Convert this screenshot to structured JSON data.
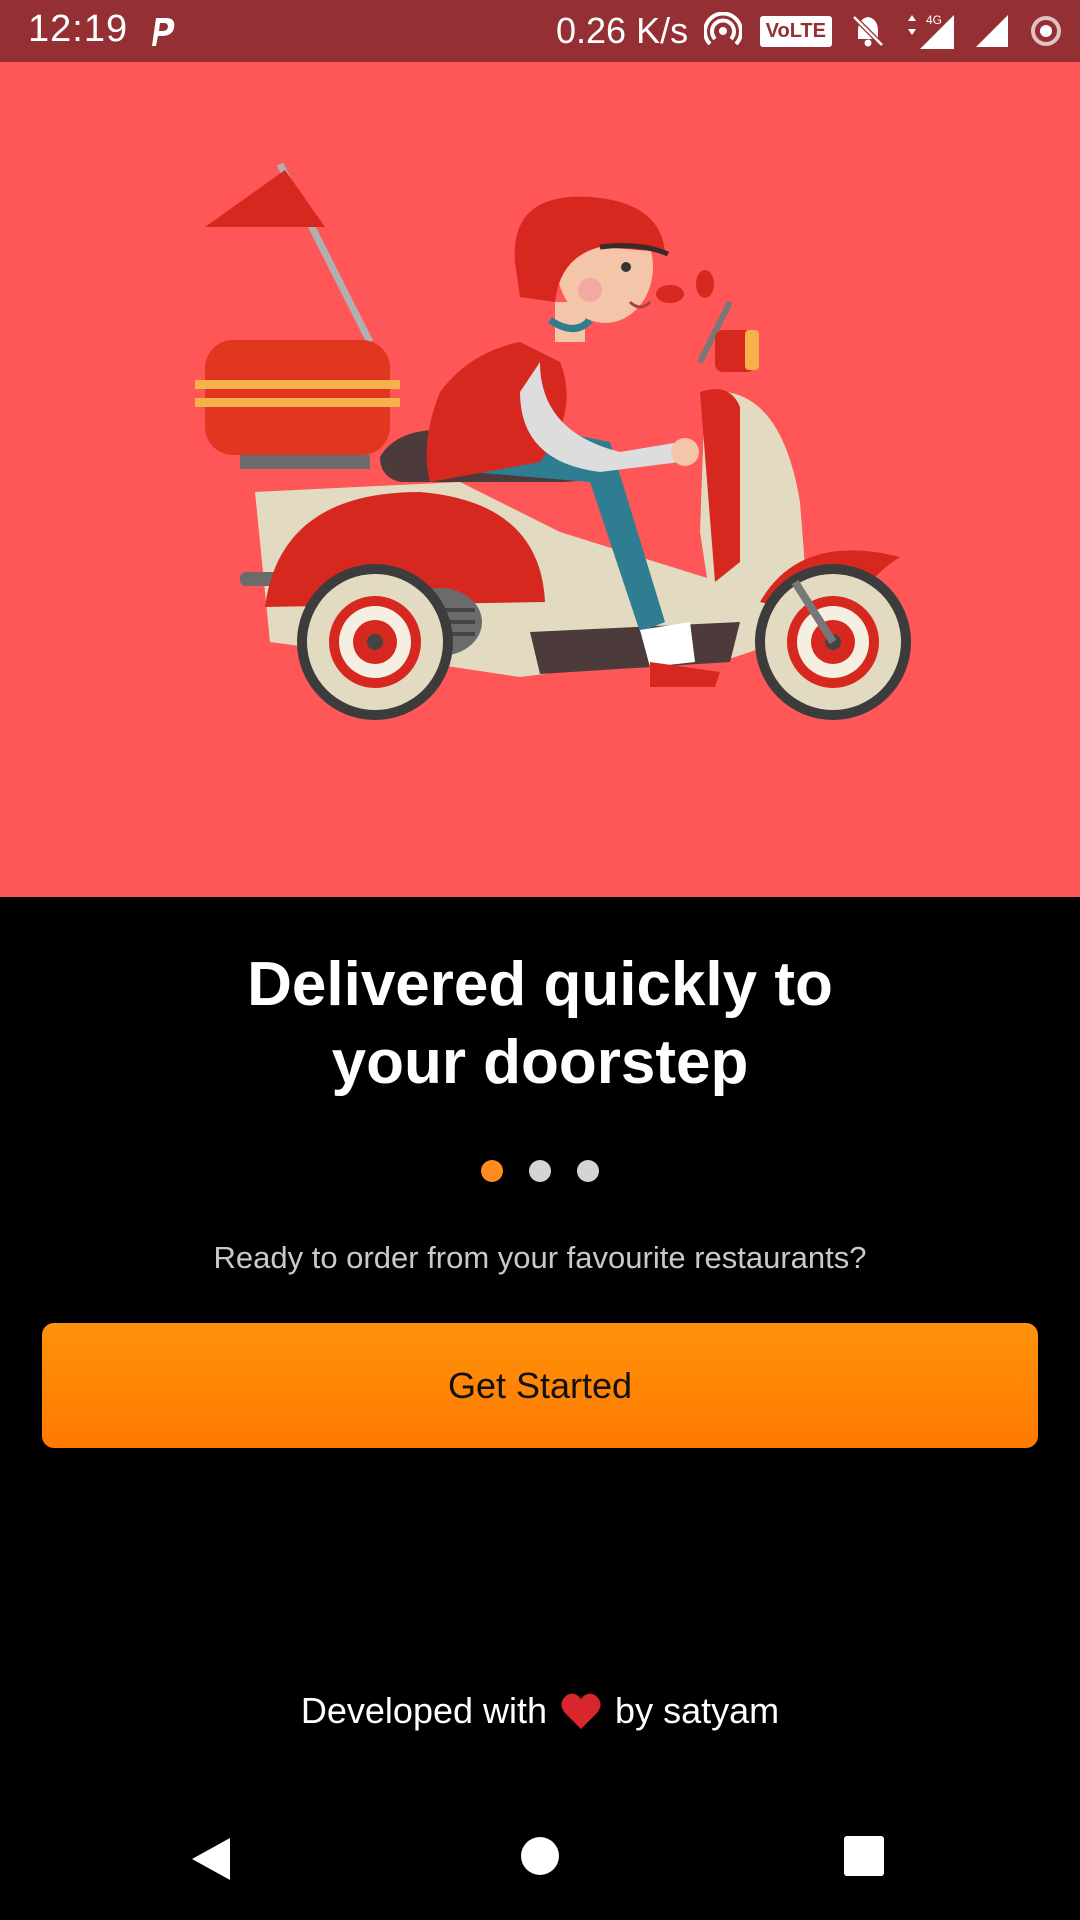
{
  "status_bar": {
    "time": "12:19",
    "network_speed": "0.26 K/s",
    "volte_label": "VoLTE",
    "network_type": "4G",
    "icons": [
      "parking-app-icon",
      "hotspot-icon",
      "volte-icon",
      "bell-muted-icon",
      "signal-4g-icon",
      "signal-icon",
      "data-saver-icon"
    ]
  },
  "hero": {
    "illustration": "delivery-scooter-rider-illustration",
    "background_color": "#ff5658"
  },
  "headline": {
    "line1": "Delivered quickly to",
    "line2": "your doorstep"
  },
  "pager": {
    "count": 3,
    "active_index": 0,
    "active_color": "#ff8a1e",
    "inactive_color": "#d4d4d4"
  },
  "subtitle": "Ready to order from your favourite restaurants?",
  "cta": {
    "label": "Get Started",
    "color": "#ff8800"
  },
  "footer": {
    "prefix": "Developed with",
    "icon": "heart-icon",
    "suffix": "by satyam"
  },
  "nav_bar": {
    "buttons": [
      "back-button",
      "home-button",
      "recents-button"
    ]
  }
}
